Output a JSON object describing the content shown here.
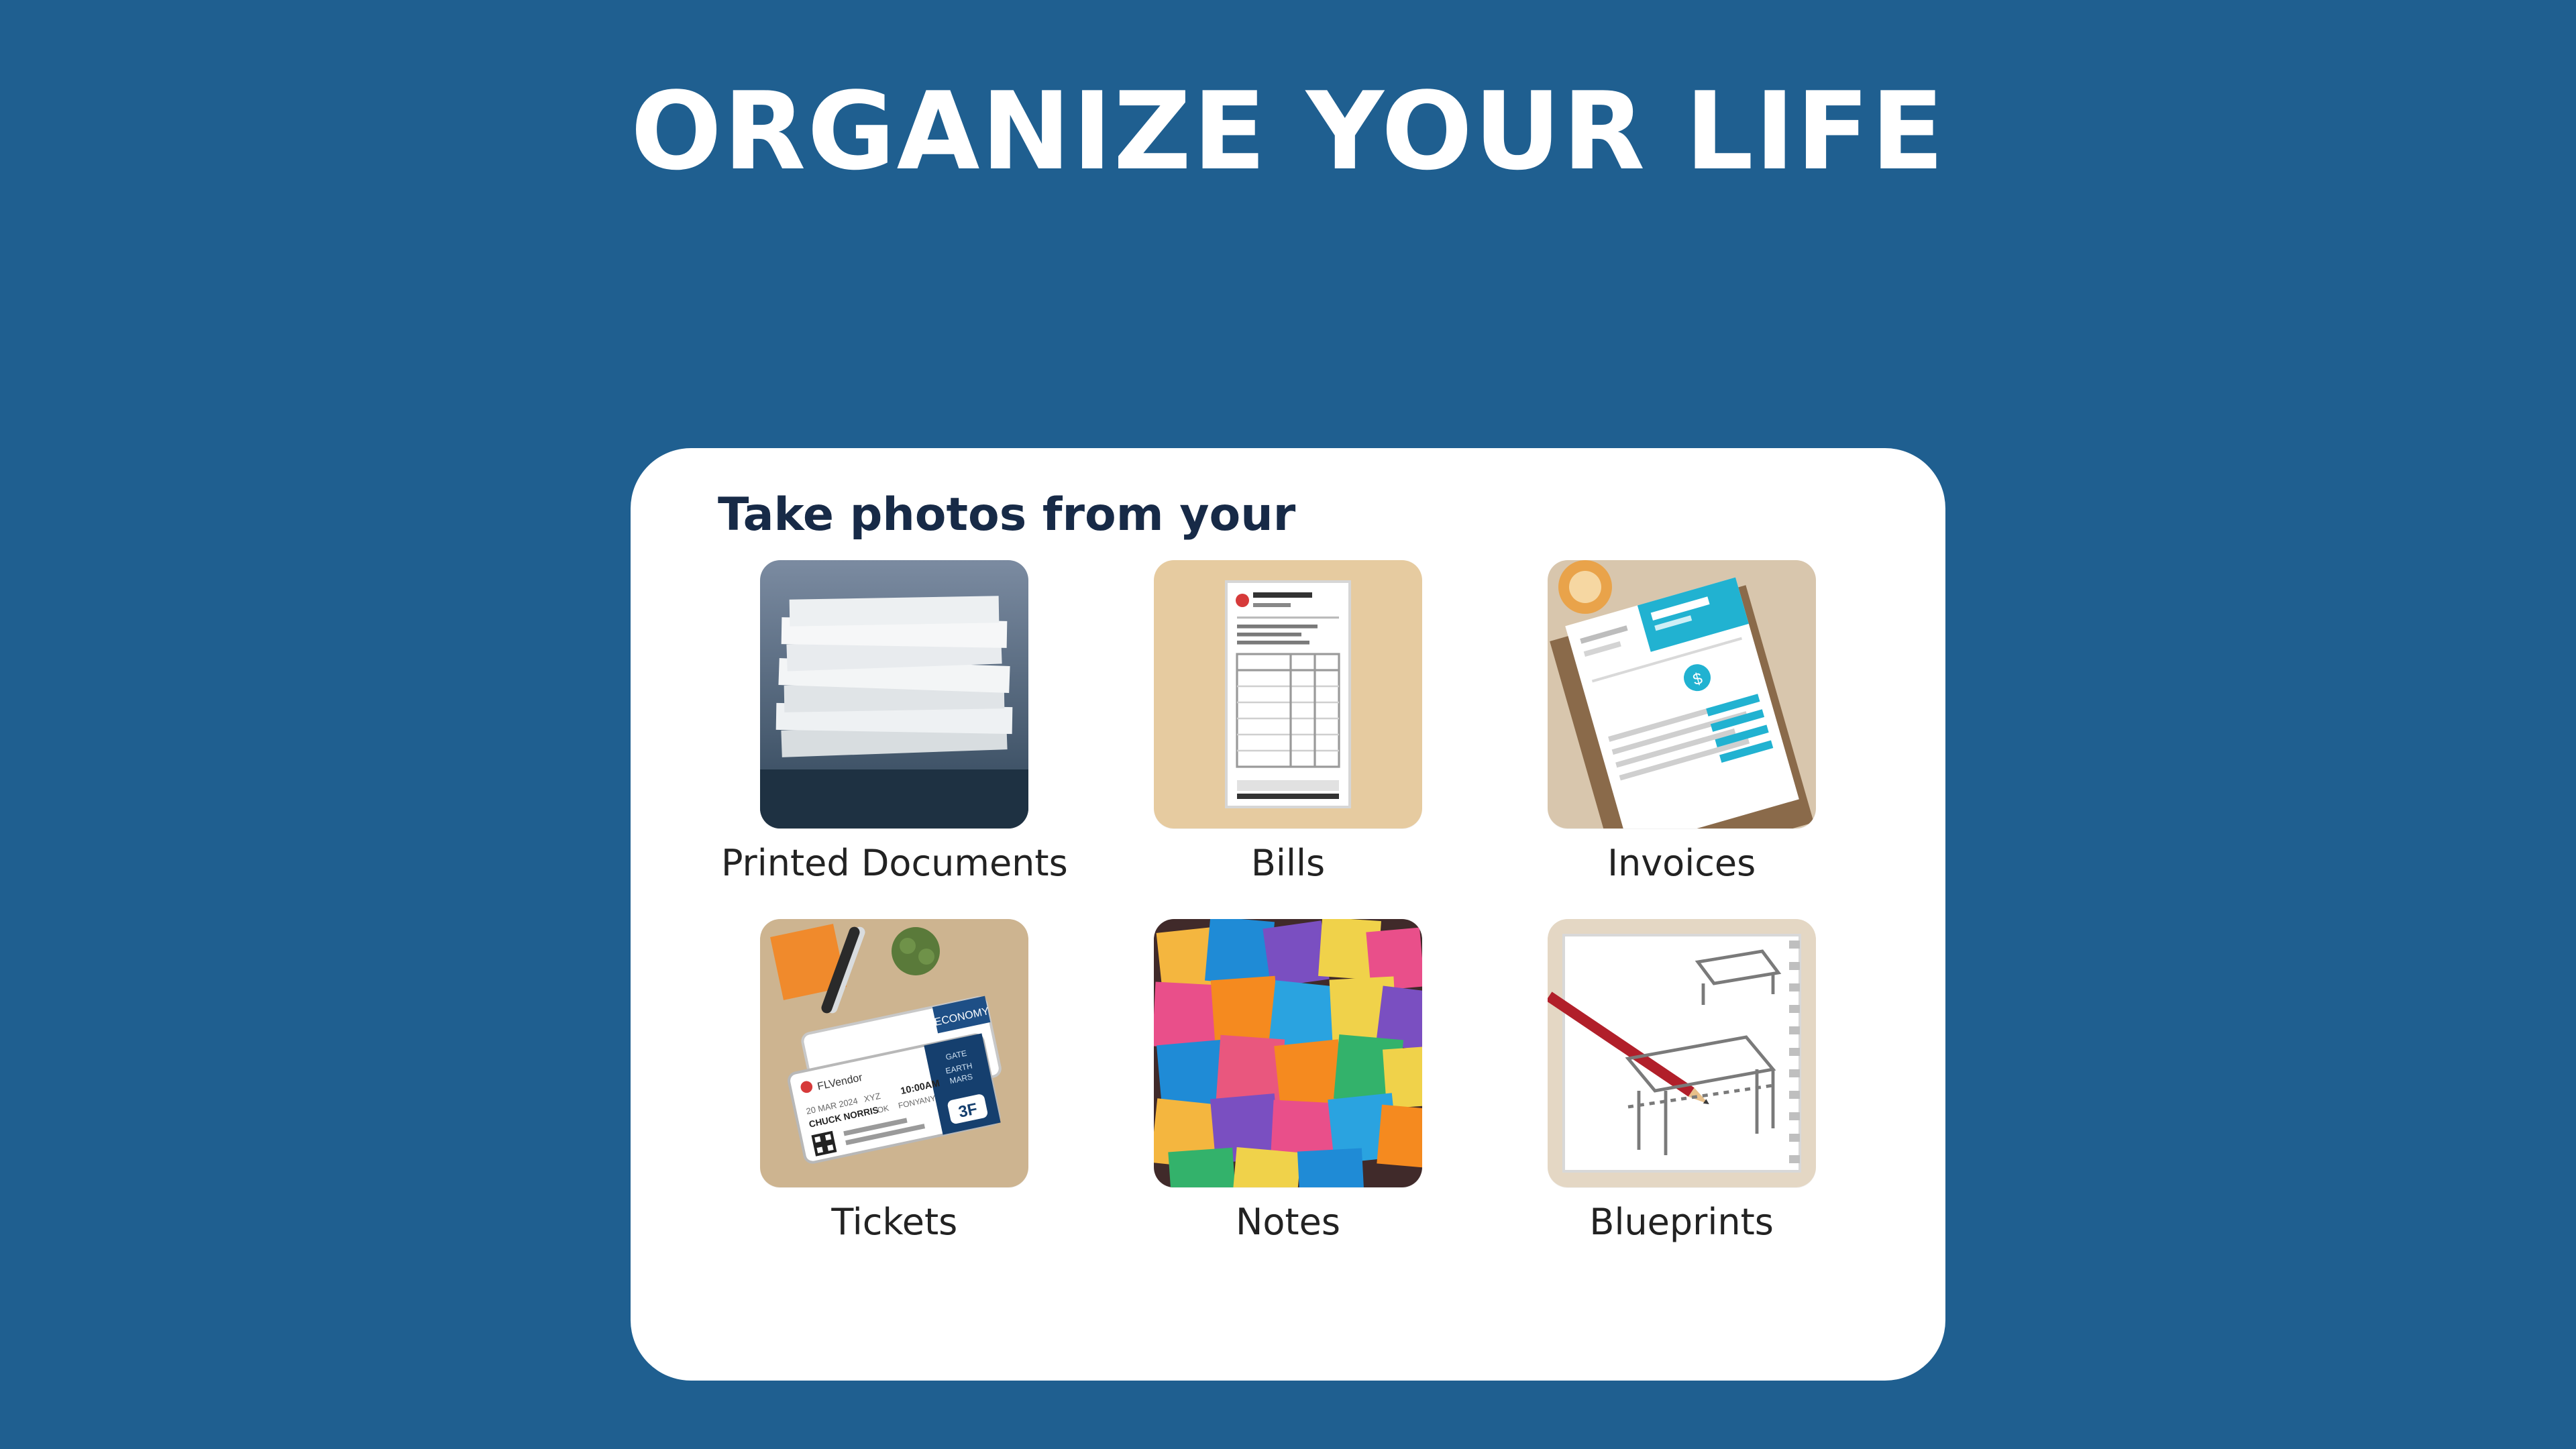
{
  "hero": {
    "title": "ORGANIZE YOUR LIFE"
  },
  "card": {
    "heading": "Take photos from your",
    "tiles": [
      {
        "label": "Printed Documents",
        "icon": "printed-documents"
      },
      {
        "label": "Bills",
        "icon": "bills"
      },
      {
        "label": "Invoices",
        "icon": "invoices"
      },
      {
        "label": "Tickets",
        "icon": "tickets"
      },
      {
        "label": "Notes",
        "icon": "notes"
      },
      {
        "label": "Blueprints",
        "icon": "blueprints"
      }
    ]
  },
  "colors": {
    "background": "#1f5f90",
    "card": "#ffffff",
    "heading": "#172a47",
    "label": "#222222"
  }
}
